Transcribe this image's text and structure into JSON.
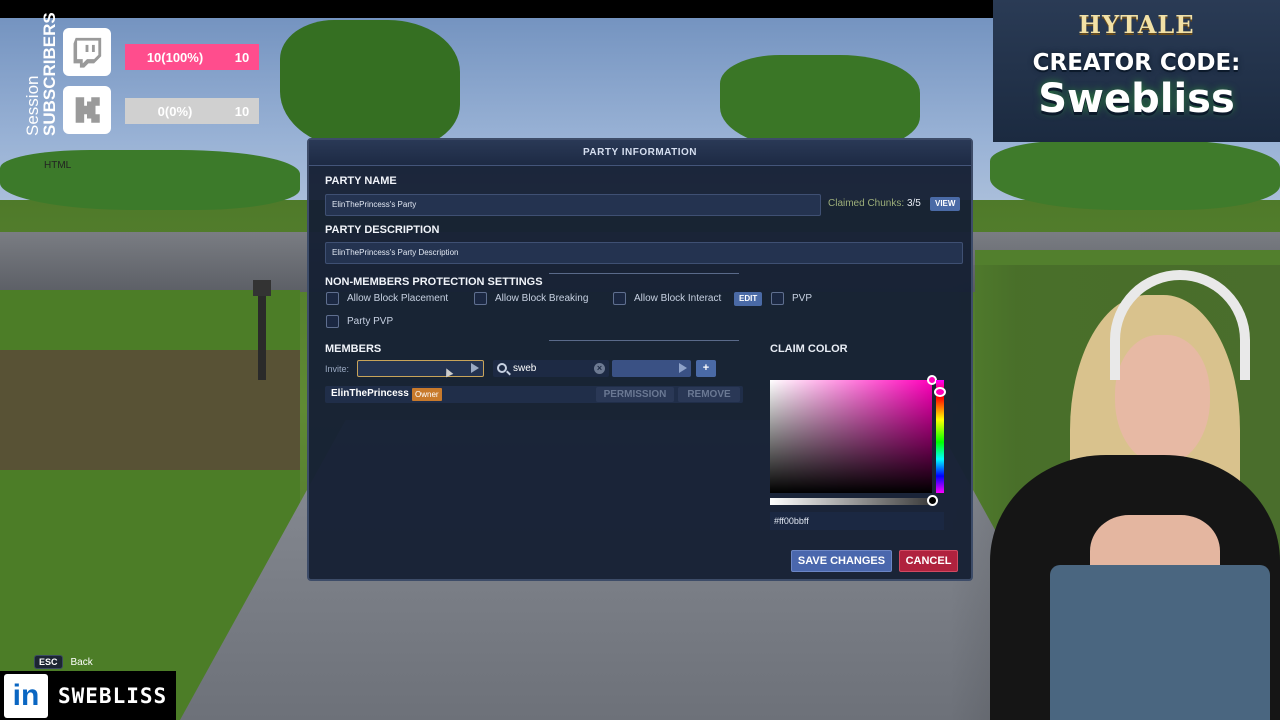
{
  "overlay": {
    "session_label": "Session",
    "subscribers_label": "SUBSCRIBERS",
    "twitch": {
      "percent_text": "10(100%)",
      "goal": "10",
      "progress": 1.0,
      "color": "#ff4d8d"
    },
    "kick": {
      "percent_text": "0(0%)",
      "goal": "10",
      "progress": 0.0,
      "color": "#53fc18"
    },
    "html_tag": "HTML"
  },
  "logo": {
    "hytale": "HYTALE",
    "creator_code": "CREATOR CODE:",
    "name": "Swebliss"
  },
  "brand": {
    "name": "SWEBLISS",
    "linkedin_icon": "linkedin-icon"
  },
  "esc_hint": {
    "key": "ESC",
    "label": "Back"
  },
  "dialog": {
    "title": "PARTY INFORMATION",
    "party_name_label": "PARTY NAME",
    "party_name_value": "ElinThePrincess's Party",
    "claimed_chunks_label": "Claimed Chunks:",
    "claimed_chunks_value": "3/5",
    "view_button": "VIEW",
    "party_description_label": "PARTY DESCRIPTION",
    "party_description_value": "ElinThePrincess's Party Description",
    "protection_label": "NON-MEMBERS PROTECTION SETTINGS",
    "checkboxes": {
      "block_placement": "Allow Block Placement",
      "block_breaking": "Allow Block Breaking",
      "block_interact": "Allow Block Interact",
      "edit_button": "EDIT",
      "pvp": "PVP",
      "party_pvp": "Party PVP"
    },
    "members_label": "MEMBERS",
    "invite_label": "Invite:",
    "search_value": "sweb",
    "add_button": "+",
    "members": [
      {
        "name": "ElinThePrincess",
        "role": "Owner"
      }
    ],
    "permission_button": "PERMISSION",
    "remove_button": "REMOVE",
    "claim_color_label": "CLAIM COLOR",
    "claim_color_hex": "#ff00bbff",
    "claim_color": "#ff00bb",
    "save_button": "SAVE CHANGES",
    "cancel_button": "CANCEL"
  }
}
